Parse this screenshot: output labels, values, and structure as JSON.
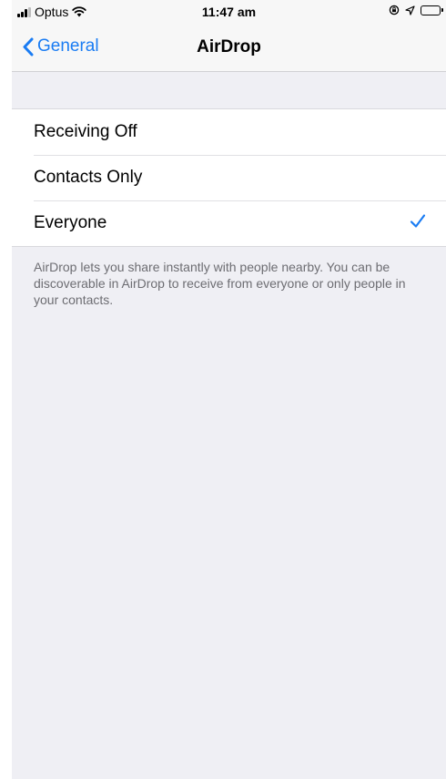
{
  "status_bar": {
    "carrier": "Optus",
    "time": "11:47 am"
  },
  "nav": {
    "back_label": "General",
    "title": "AirDrop"
  },
  "options": [
    {
      "label": "Receiving Off",
      "selected": false
    },
    {
      "label": "Contacts Only",
      "selected": false
    },
    {
      "label": "Everyone",
      "selected": true
    }
  ],
  "footer": "AirDrop lets you share instantly with people nearby. You can be discoverable in AirDrop to receive from everyone or only people in your contacts.",
  "colors": {
    "accent": "#1a7cf3",
    "background": "#efeff4",
    "battery": "#4cd964"
  }
}
